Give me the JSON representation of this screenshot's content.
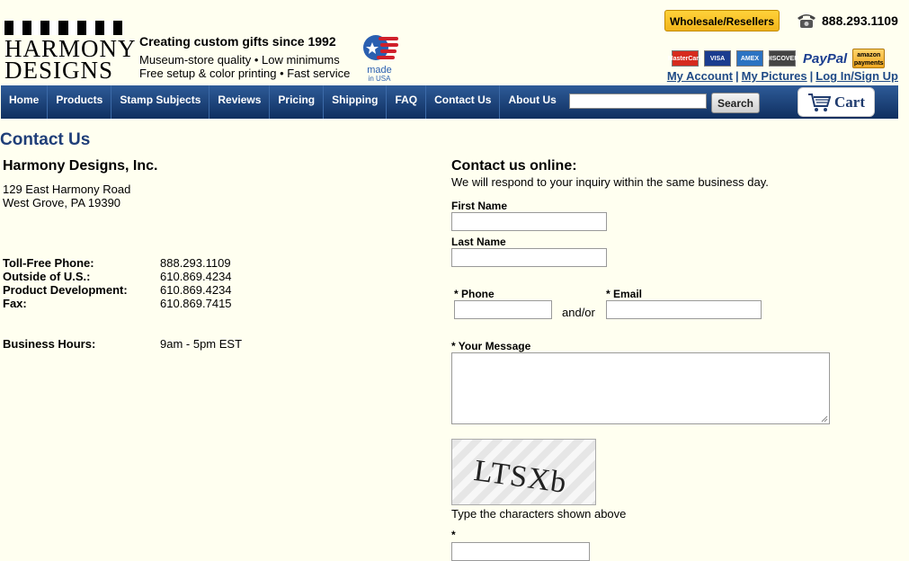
{
  "logo": {
    "line1": "HARMONY",
    "line2": "DESIGNS"
  },
  "tagline": {
    "title": "Creating custom gifts since 1992",
    "line1": "Museum-store quality • Low minimums",
    "line2": "Free setup & color printing • Fast service"
  },
  "badge": {
    "made": "made",
    "in_usa": "in USA"
  },
  "header": {
    "wholesale_label": "Wholesale/Resellers",
    "phone": "888.293.1109",
    "payment_cards": [
      {
        "label": "MasterCard",
        "color": "#d62a1e"
      },
      {
        "label": "VISA",
        "color": "#1a3c8f"
      },
      {
        "label": "AMEX",
        "color": "#2b73c2"
      },
      {
        "label": "DISCOVER",
        "color": "#444444"
      }
    ],
    "paypal": "PayPal",
    "amazon_line1": "amazon",
    "amazon_line2": "payments",
    "account_links": {
      "my_account": "My Account",
      "my_pictures": "My Pictures",
      "login": "Log In/Sign Up",
      "separator": "|"
    }
  },
  "nav": {
    "items": [
      "Home",
      "Products",
      "Stamp Subjects",
      "Reviews",
      "Pricing",
      "Shipping",
      "FAQ",
      "Contact Us",
      "About Us"
    ],
    "search_button": "Search",
    "cart_label": "Cart"
  },
  "page_title": "Contact Us",
  "company": {
    "name": "Harmony Designs, Inc.",
    "address_line1": "129 East Harmony Road",
    "address_line2": "West Grove, PA 19390",
    "contacts": [
      {
        "label": "Toll-Free Phone:",
        "value": "888.293.1109"
      },
      {
        "label": "Outside of U.S.:",
        "value": "610.869.4234"
      },
      {
        "label": "Product Development:",
        "value": "610.869.4234"
      },
      {
        "label": "Fax:",
        "value": "610.869.7415"
      }
    ],
    "hours_label": "Business Hours:",
    "hours_value": "9am - 5pm EST"
  },
  "form": {
    "title": "Contact us online:",
    "subtitle": "We will respond to your inquiry within the same business day.",
    "first_name_label": "First Name",
    "last_name_label": "Last Name",
    "phone_label": "* Phone",
    "andor": "and/or",
    "email_label": "* Email",
    "message_label": "* Your Message",
    "captcha_text": "LTSXb",
    "captcha_hint": "Type the characters shown above",
    "captcha_required": "*"
  },
  "colors": {
    "nav_bg": "#1a3f73",
    "link": "#1f4a86",
    "page_bg": "#fffff0",
    "title": "#1f3e78"
  }
}
